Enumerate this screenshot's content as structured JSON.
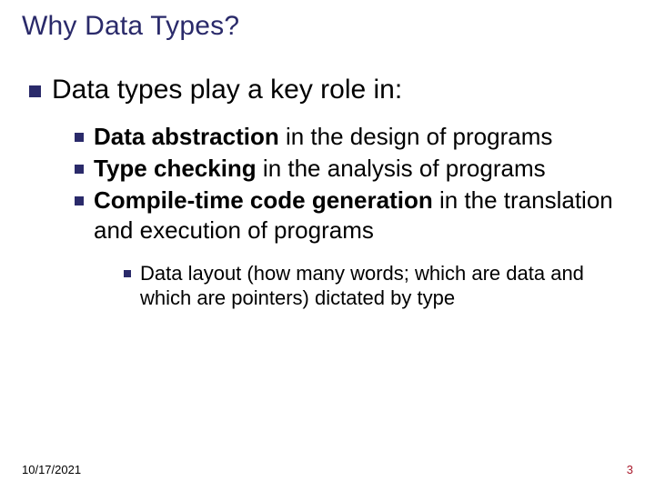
{
  "title": "Why Data Types?",
  "lvl1": {
    "text": "Data types play a key role in:"
  },
  "lvl2": [
    {
      "bold": "Data abstraction",
      "rest": " in the design of programs"
    },
    {
      "bold": "Type checking",
      "rest": " in the analysis of programs"
    },
    {
      "bold": "Compile-time code generation",
      "rest": " in the translation and execution  of programs"
    }
  ],
  "lvl3": [
    {
      "text": "Data layout (how many words; which are data and which are pointers) dictated by type"
    }
  ],
  "footer": {
    "date": "10/17/2021",
    "page": "3"
  }
}
